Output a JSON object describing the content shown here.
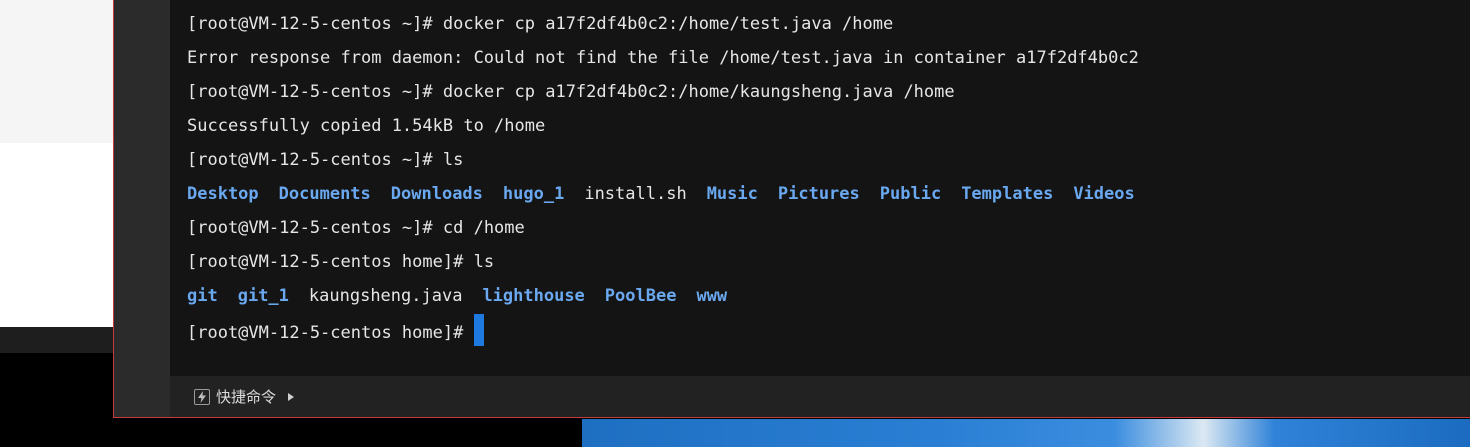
{
  "terminal": {
    "prompt_home": "[root@VM-12-5-centos ~]#",
    "prompt_home_dir": "[root@VM-12-5-centos home]#",
    "lines": {
      "l1_cmd": " docker cp a17f2df4b0c2:/home/test.java /home",
      "l2_out": "Error response from daemon: Could not find the file /home/test.java in container a17f2df4b0c2",
      "l3_cmd": " docker cp a17f2df4b0c2:/home/kaungsheng.java /home",
      "l4_out": "Successfully copied 1.54kB to /home",
      "l5_cmd": " ls",
      "l7_cmd": " cd /home",
      "l8_cmd": " ls"
    },
    "ls_root": [
      "Desktop",
      "Documents",
      "Downloads",
      "hugo_1",
      "install.sh",
      "Music",
      "Pictures",
      "Public",
      "Templates",
      "Videos"
    ],
    "ls_home": [
      "git",
      "git_1",
      "kaungsheng.java",
      "lighthouse",
      "PoolBee",
      "www"
    ]
  },
  "bottom_bar": {
    "quick_commands_label": "快捷命令",
    "icon": "bolt-icon",
    "expand_icon": "triangle-right-icon"
  },
  "colors": {
    "directory": "#6aa8f0",
    "cursor": "#1f7ae0",
    "window_border": "#c73a3a"
  }
}
